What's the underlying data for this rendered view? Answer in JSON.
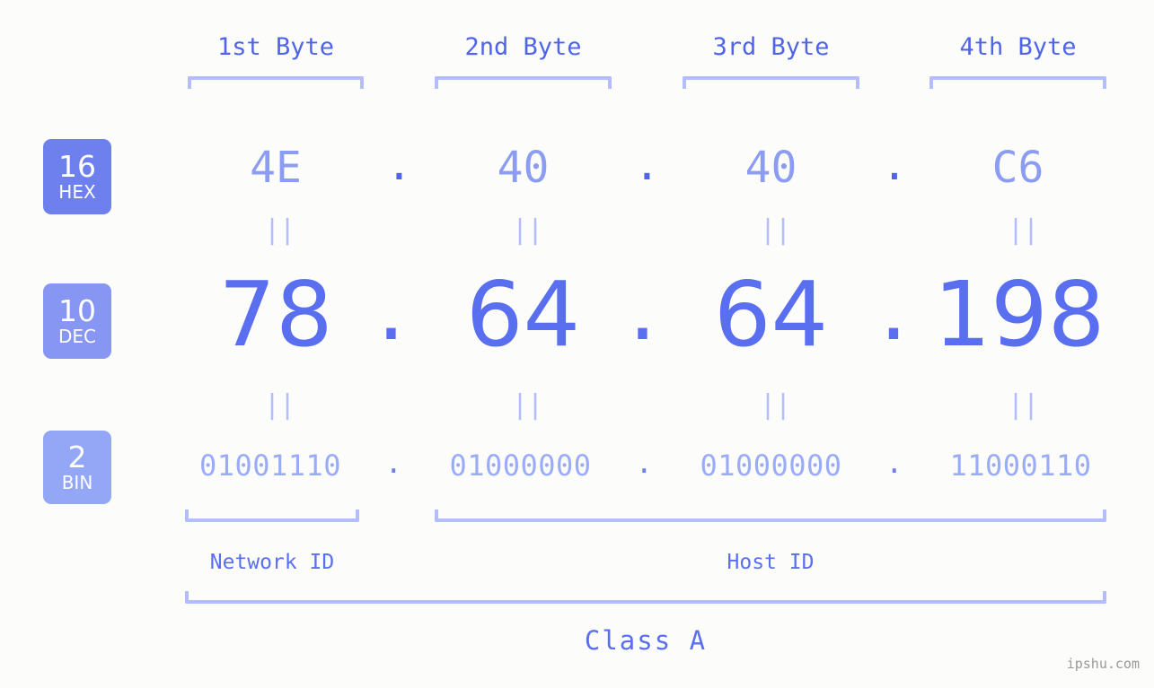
{
  "meta": {
    "background_color": "#fcfdfa",
    "accent_color": "#5a6ff0",
    "bracket_color": "#b4bdfb",
    "watermark": "ipshu.com"
  },
  "byte_headers": [
    {
      "label": "1st Byte"
    },
    {
      "label": "2nd Byte"
    },
    {
      "label": "3rd Byte"
    },
    {
      "label": "4th Byte"
    }
  ],
  "bases": [
    {
      "number": "16",
      "name": "HEX",
      "color": "#6e80ed"
    },
    {
      "number": "10",
      "name": "DEC",
      "color": "#8896f3"
    },
    {
      "number": "2",
      "name": "BIN",
      "color": "#93a7f6"
    }
  ],
  "rows": {
    "hex": {
      "base_number": "16",
      "base_name": "HEX",
      "octets": [
        "4E",
        "40",
        "40",
        "C6"
      ],
      "separator": "."
    },
    "dec": {
      "base_number": "10",
      "base_name": "DEC",
      "octets": [
        "78",
        "64",
        "64",
        "198"
      ],
      "separator": "."
    },
    "bin": {
      "base_number": "2",
      "base_name": "BIN",
      "octets": [
        "01001110",
        "01000000",
        "01000000",
        "11000110"
      ],
      "separator": "."
    }
  },
  "equals_marks": {
    "glyph": "||",
    "hex_to_dec": [
      "||",
      "||",
      "||",
      "||"
    ],
    "dec_to_bin": [
      "||",
      "||",
      "||",
      "||"
    ]
  },
  "footer": {
    "network_id_label": "Network ID",
    "host_id_label": "Host ID",
    "class_label": "Class A"
  }
}
